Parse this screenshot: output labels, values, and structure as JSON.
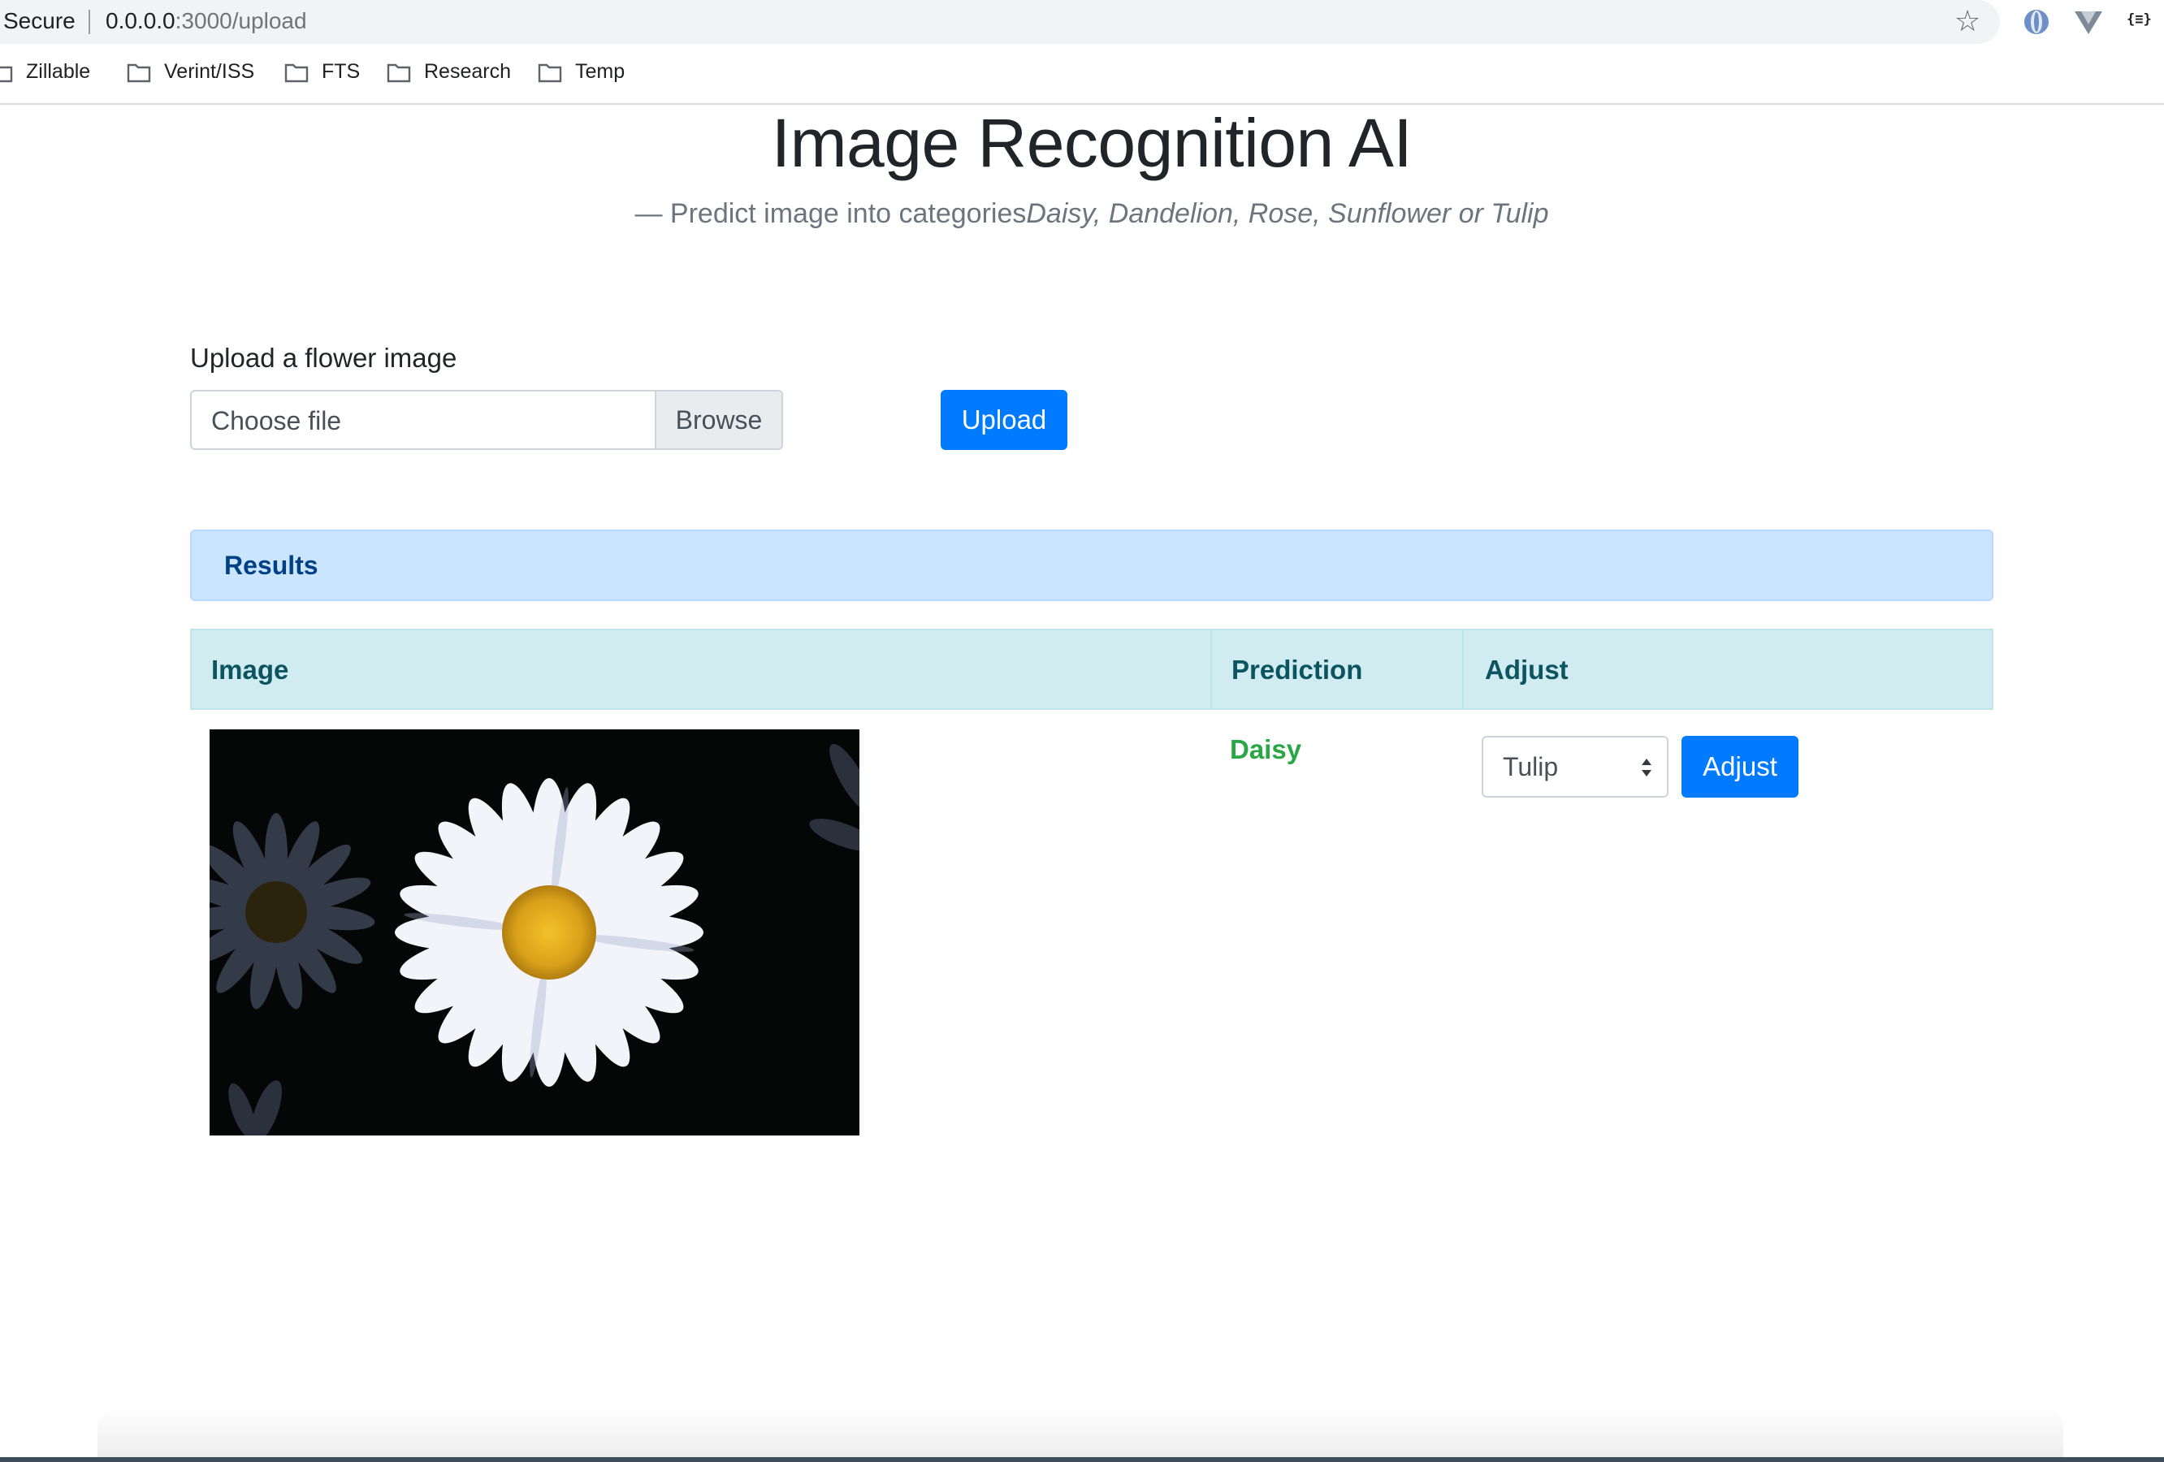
{
  "browser": {
    "security": "Secure",
    "url_host": "0.0.0.0",
    "url_path": ":3000/upload",
    "bookmarks": [
      "Zillable",
      "Verint/ISS",
      "FTS",
      "Research",
      "Temp"
    ],
    "extension_3_label": "{≡}"
  },
  "page": {
    "title": "Image Recognition AI",
    "subtitle_prefix": "— Predict image into categories",
    "subtitle_categories": "Daisy, Dandelion, Rose, Sunflower or Tulip"
  },
  "upload_form": {
    "label": "Upload a flower image",
    "file_placeholder": "Choose file",
    "browse_label": "Browse",
    "upload_label": "Upload"
  },
  "results": {
    "header": "Results",
    "columns": [
      "Image",
      "Prediction",
      "Adjust"
    ],
    "rows": [
      {
        "image_icon": "daisy-photo",
        "prediction": "Daisy",
        "prediction_color": "#28a745",
        "adjust_selected": "Tulip",
        "adjust_button": "Adjust"
      }
    ]
  },
  "colors": {
    "primary": "#007bff",
    "alert_bg": "#cce5ff",
    "table_head_bg": "#d1ecf1"
  }
}
